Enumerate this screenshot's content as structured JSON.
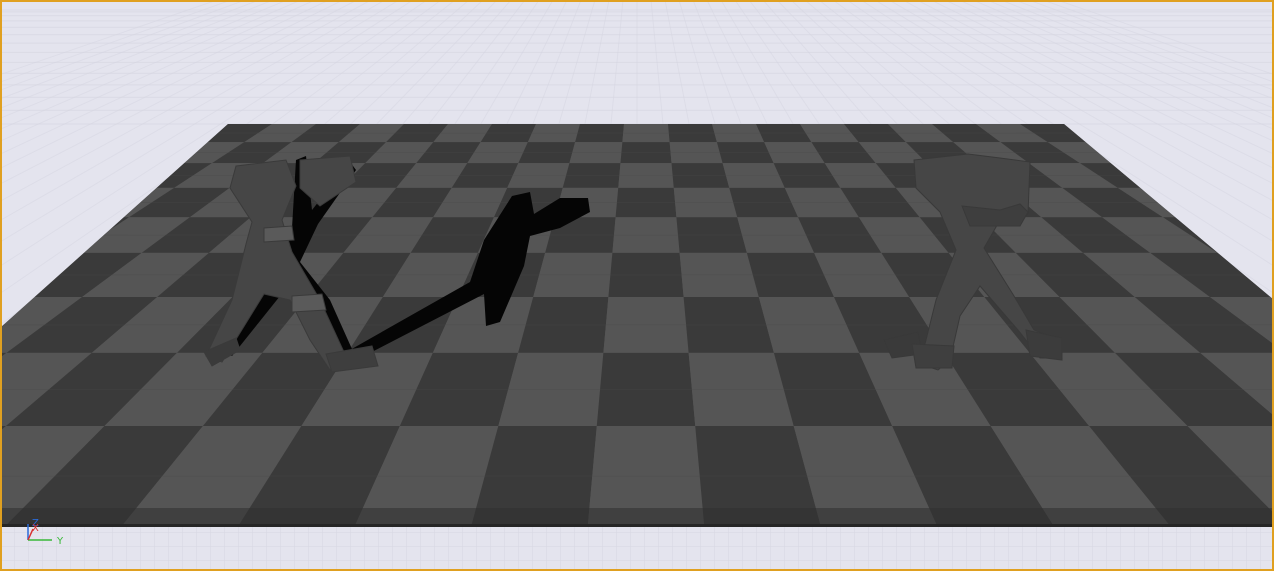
{
  "viewport": {
    "view": "perspective",
    "highlight_color": "#e0a020",
    "background_color": "#e4e4ee",
    "grid_line_color": "#d0d0de",
    "floor": {
      "type": "checkerboard",
      "light_tile_color": "#555555",
      "dark_tile_color": "#3a3a3a",
      "front_edge_color": "#2e2e2e"
    },
    "objects": [
      {
        "name": "mannequin-left",
        "shadow": true
      },
      {
        "name": "mannequin-right",
        "shadow": false
      }
    ]
  },
  "axis_gizmo": {
    "z_label": "Z",
    "x_label": "X",
    "y_label": "Y",
    "z_color": "#2a6bd8",
    "x_color": "#d83030",
    "y_color": "#38b838"
  }
}
